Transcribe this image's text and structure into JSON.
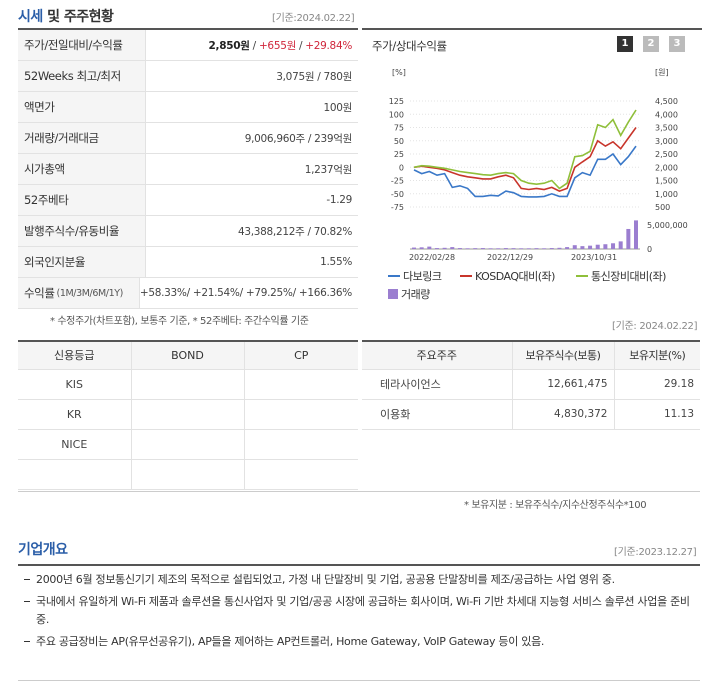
{
  "summary": {
    "title_blue": "시세",
    "title_rest": " 및 주주현황",
    "stamp": "[기준:2024.02.22]",
    "rows": [
      {
        "k": "주가/전일대비/수익률",
        "price": "2,850원",
        "diff": "+655원",
        "rate": "+29.84%"
      },
      {
        "k": "52Weeks 최고/최저",
        "v": "3,075원 / 780원"
      },
      {
        "k": "액면가",
        "v": "100원"
      },
      {
        "k": "거래량/거래대금",
        "v": "9,006,960주 / 239억원"
      },
      {
        "k": "시가총액",
        "v": "1,237억원"
      },
      {
        "k": "52주베타",
        "v": "-1.29"
      },
      {
        "k": "발행주식수/유동비율",
        "v": "43,388,212주 / 70.82%"
      },
      {
        "k": "외국인지분율",
        "v": "1.55%"
      },
      {
        "k": "수익률",
        "ksub": "(1M/3M/6M/1Y)",
        "v": "+58.33%/ +21.54%/ +79.25%/ +166.36%"
      }
    ],
    "footnote": "* 수정주가(차트포함), 보통주 기준, * 52주베타: 주간수익률 기준"
  },
  "chart": {
    "title": "주가/상대수익률",
    "pages": [
      "1",
      "2",
      "3"
    ],
    "left_unit": "[%]",
    "right_unit": "[원]",
    "legend": {
      "s1": "다보링크",
      "s2": "KOSDAQ대비(좌)",
      "s3": "통신장비대비(좌)",
      "vol": "거래량"
    },
    "colors": {
      "s1": "#3a78c8",
      "s2": "#c8352b",
      "s3": "#8fbf3a",
      "vol": "#9b7ed0"
    }
  },
  "chart_data": {
    "type": "line",
    "left_axis": {
      "label": "[%]",
      "ticks": [
        125,
        100,
        75,
        50,
        25,
        0,
        -25,
        -50,
        -75
      ],
      "range": [
        -75,
        125
      ]
    },
    "right_axis": {
      "label": "[원]",
      "ticks": [
        4500,
        4000,
        3500,
        3000,
        2500,
        2000,
        1500,
        1000,
        500
      ],
      "range": [
        500,
        4500
      ]
    },
    "volume_axis": {
      "ticks": [
        5000000,
        0
      ],
      "tick_labels": [
        "5,000,000",
        "0"
      ]
    },
    "x_ticks": [
      "2022/02/28",
      "2022/12/29",
      "2023/10/31"
    ],
    "series": [
      {
        "name": "다보링크",
        "values": [
          -5,
          -12,
          -8,
          -15,
          -12,
          -38,
          -35,
          -40,
          -55,
          -55,
          -53,
          -54,
          -45,
          -48,
          -55,
          -56,
          -56,
          -55,
          -50,
          -55,
          -55,
          -20,
          -10,
          -15,
          15,
          15,
          25,
          5,
          20,
          40
        ]
      },
      {
        "name": "KOSDAQ대비(좌)",
        "values": [
          0,
          2,
          0,
          -2,
          -5,
          -10,
          -15,
          -18,
          -20,
          -22,
          -22,
          -18,
          -15,
          -20,
          -40,
          -42,
          -40,
          -42,
          -38,
          -45,
          -40,
          0,
          10,
          20,
          50,
          40,
          48,
          35,
          55,
          75
        ]
      },
      {
        "name": "통신장비대비(좌)",
        "values": [
          0,
          3,
          2,
          0,
          -2,
          -5,
          -8,
          -10,
          -12,
          -14,
          -15,
          -12,
          -10,
          -12,
          -25,
          -30,
          -32,
          -30,
          -25,
          -40,
          -30,
          20,
          22,
          30,
          80,
          75,
          90,
          60,
          85,
          108
        ]
      },
      {
        "name": "거래량",
        "values": [
          300000,
          350000,
          500000,
          200000,
          250000,
          400000,
          200000,
          150000,
          180000,
          200000,
          150000,
          150000,
          200000,
          180000,
          150000,
          150000,
          180000,
          150000,
          200000,
          250000,
          400000,
          800000,
          600000,
          700000,
          900000,
          1000000,
          1200000,
          1600000,
          4200000,
          6000000
        ]
      }
    ]
  },
  "credit": {
    "headers": [
      "신용등급",
      "BOND",
      "CP"
    ],
    "rows": [
      [
        "KIS",
        "",
        ""
      ],
      [
        "KR",
        "",
        ""
      ],
      [
        "NICE",
        "",
        ""
      ],
      [
        "",
        "",
        ""
      ]
    ]
  },
  "holders": {
    "stamp": "[기준: 2024.02.22]",
    "headers": [
      "주요주주",
      "보유주식수(보통)",
      "보유지분(%)"
    ],
    "rows": [
      [
        "테라사이언스",
        "12,661,475",
        "29.18"
      ],
      [
        "이용화",
        "4,830,372",
        "11.13"
      ]
    ],
    "footnote": "* 보유지분 : 보유주식수/지수산정주식수*100"
  },
  "overview": {
    "title": "기업개요",
    "stamp": "[기준:2023.12.27]",
    "items": [
      "2000년 6월 정보통신기기 제조의 목적으로 설립되었고, 가정 내 단말장비 및 기업, 공공용 단말장비를 제조/공급하는 사업 영위 중.",
      "국내에서 유일하게 Wi-Fi 제품과 솔루션을 통신사업자 및 기업/공공 시장에 공급하는 회사이며, Wi-Fi 기반 차세대 지능형 서비스 솔루션 사업을 준비 중.",
      "주요 공급장비는 AP(유무선공유기), AP들을 제어하는 AP컨트롤러, Home Gateway, VoIP Gateway 등이 있음."
    ]
  }
}
